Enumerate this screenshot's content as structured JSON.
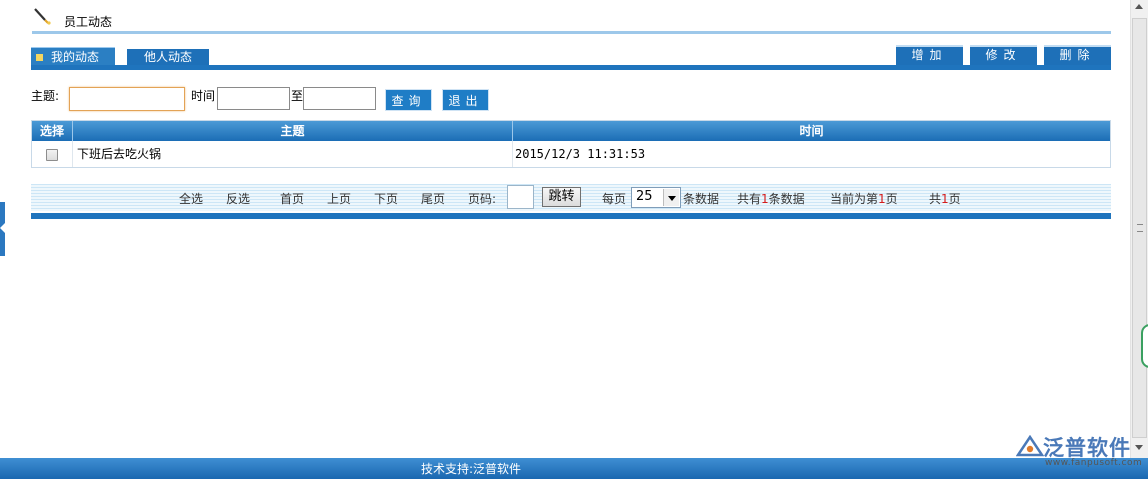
{
  "header": {
    "title": "员工动态"
  },
  "tabs": [
    {
      "label": "我的动态",
      "active": true
    },
    {
      "label": "他人动态",
      "active": false
    }
  ],
  "actions": {
    "add": "增加",
    "edit": "修改",
    "delete": "删除"
  },
  "search": {
    "subject_label": "主题:",
    "subject_value": "",
    "time_label": "时间",
    "time_from_value": "",
    "to_label": "至",
    "time_to_value": "",
    "query_button": "查询",
    "exit_button": "退出"
  },
  "table": {
    "columns": [
      "选择",
      "主题",
      "时间"
    ],
    "rows": [
      {
        "checked": false,
        "subject": "下班后去吃火锅",
        "time": "2015/12/3 11:31:53"
      }
    ]
  },
  "pager": {
    "select_all": "全选",
    "invert": "反选",
    "first": "首页",
    "prev": "上页",
    "next": "下页",
    "last": "尾页",
    "page_label": "页码:",
    "page_value": "",
    "jump_button": "跳转",
    "per_page_label": "每页",
    "per_page_value": "25",
    "per_page_suffix": "条数据",
    "total_prefix": "共有",
    "total_count": "1",
    "total_suffix": "条数据",
    "current_prefix": "当前为第",
    "current_page": "1",
    "current_suffix": "页",
    "pages_prefix": "共",
    "pages_count": "1",
    "pages_suffix": "页"
  },
  "footer": {
    "text": "技术支持:泛普软件"
  },
  "watermark": {
    "name": "泛普软件",
    "url": "www.fanpusoft.com"
  },
  "colors": {
    "accent": "#1f74bd",
    "highlight": "#d41b1b"
  }
}
